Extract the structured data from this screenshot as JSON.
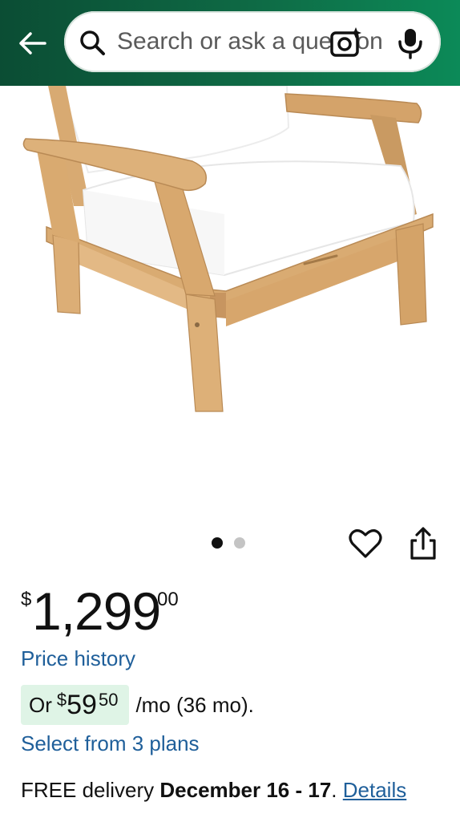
{
  "header": {
    "search_placeholder": "Search or ask a question"
  },
  "carousel": {
    "total": 2,
    "active_index": 0
  },
  "price": {
    "currency": "$",
    "dollars": "1,299",
    "cents": "00",
    "history_link": "Price history"
  },
  "monthly": {
    "prefix": "Or",
    "currency": "$",
    "dollars": "59",
    "cents": "50",
    "suffix": "/mo (36 mo)."
  },
  "plans_link": "Select from 3 plans",
  "delivery": {
    "prefix": "FREE delivery",
    "dates": "December 16 - 17",
    "separator": ".",
    "details_link": "Details"
  },
  "colors": {
    "header_green": "#0e6a45",
    "link_blue": "#1f5f9a",
    "monthly_highlight": "#dff4e6"
  },
  "icons": {
    "back": "arrow-left-icon",
    "search": "search-icon",
    "camera": "camera-sparkle-icon",
    "mic": "microphone-icon",
    "favorite": "heart-icon",
    "share": "share-icon"
  }
}
